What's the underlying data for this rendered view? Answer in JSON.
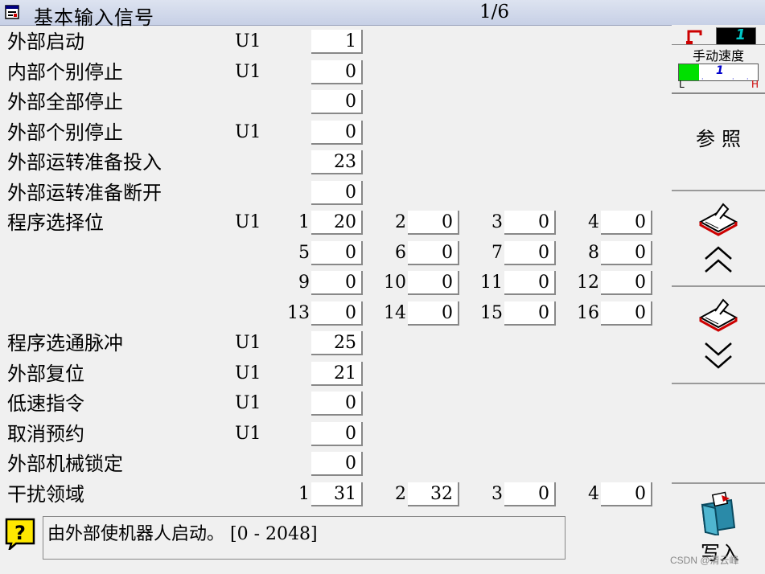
{
  "window": {
    "title": "基本输入信号",
    "page_indicator": "1/6"
  },
  "rows": [
    {
      "label": "外部启动",
      "unit": "U1",
      "value": "1"
    },
    {
      "label": "内部个别停止",
      "unit": "U1",
      "value": "0"
    },
    {
      "label": "外部全部停止",
      "unit": "",
      "value": "0"
    },
    {
      "label": "外部个别停止",
      "unit": "U1",
      "value": "0"
    },
    {
      "label": "外部运转准备投入",
      "unit": "",
      "value": "23"
    },
    {
      "label": "外部运转准备断开",
      "unit": "",
      "value": "0"
    },
    {
      "label": "程序选择位",
      "unit": "U1"
    },
    {
      "label": "程序选通脉冲",
      "unit": "U1",
      "value": "25"
    },
    {
      "label": "外部复位",
      "unit": "U1",
      "value": "21"
    },
    {
      "label": "低速指令",
      "unit": "U1",
      "value": "0"
    },
    {
      "label": "取消预约",
      "unit": "U1",
      "value": "0"
    },
    {
      "label": "外部机械锁定",
      "unit": "",
      "value": "0"
    },
    {
      "label": "干扰领域",
      "unit": ""
    }
  ],
  "program_select_bits": [
    {
      "index": "1",
      "value": "20"
    },
    {
      "index": "2",
      "value": "0"
    },
    {
      "index": "3",
      "value": "0"
    },
    {
      "index": "4",
      "value": "0"
    },
    {
      "index": "5",
      "value": "0"
    },
    {
      "index": "6",
      "value": "0"
    },
    {
      "index": "7",
      "value": "0"
    },
    {
      "index": "8",
      "value": "0"
    },
    {
      "index": "9",
      "value": "0"
    },
    {
      "index": "10",
      "value": "0"
    },
    {
      "index": "11",
      "value": "0"
    },
    {
      "index": "12",
      "value": "0"
    },
    {
      "index": "13",
      "value": "0"
    },
    {
      "index": "14",
      "value": "0"
    },
    {
      "index": "15",
      "value": "0"
    },
    {
      "index": "16",
      "value": "0"
    }
  ],
  "interference_areas": [
    {
      "index": "1",
      "value": "31"
    },
    {
      "index": "2",
      "value": "32"
    },
    {
      "index": "3",
      "value": "0"
    },
    {
      "index": "4",
      "value": "0"
    }
  ],
  "help": {
    "message": "由外部使机器人启动。  [0 - 2048]"
  },
  "status": {
    "tool_number": "1",
    "speed_label": "手动速度",
    "speed_value": "1",
    "speed_low": "L",
    "speed_high": "H",
    "speed_level_fraction": 0.25
  },
  "side_buttons": {
    "reference": "参照",
    "write": "写入"
  },
  "watermark": "CSDN @清云峰",
  "colors": {
    "titlebar": "#c7d0e6",
    "speed_bar": "#00e000",
    "speed_value": "#0000cc",
    "tool_box": "#000000",
    "tool_value": "#00c8c8",
    "icon_red": "#cc0000",
    "help_yellow": "#ffe800"
  }
}
